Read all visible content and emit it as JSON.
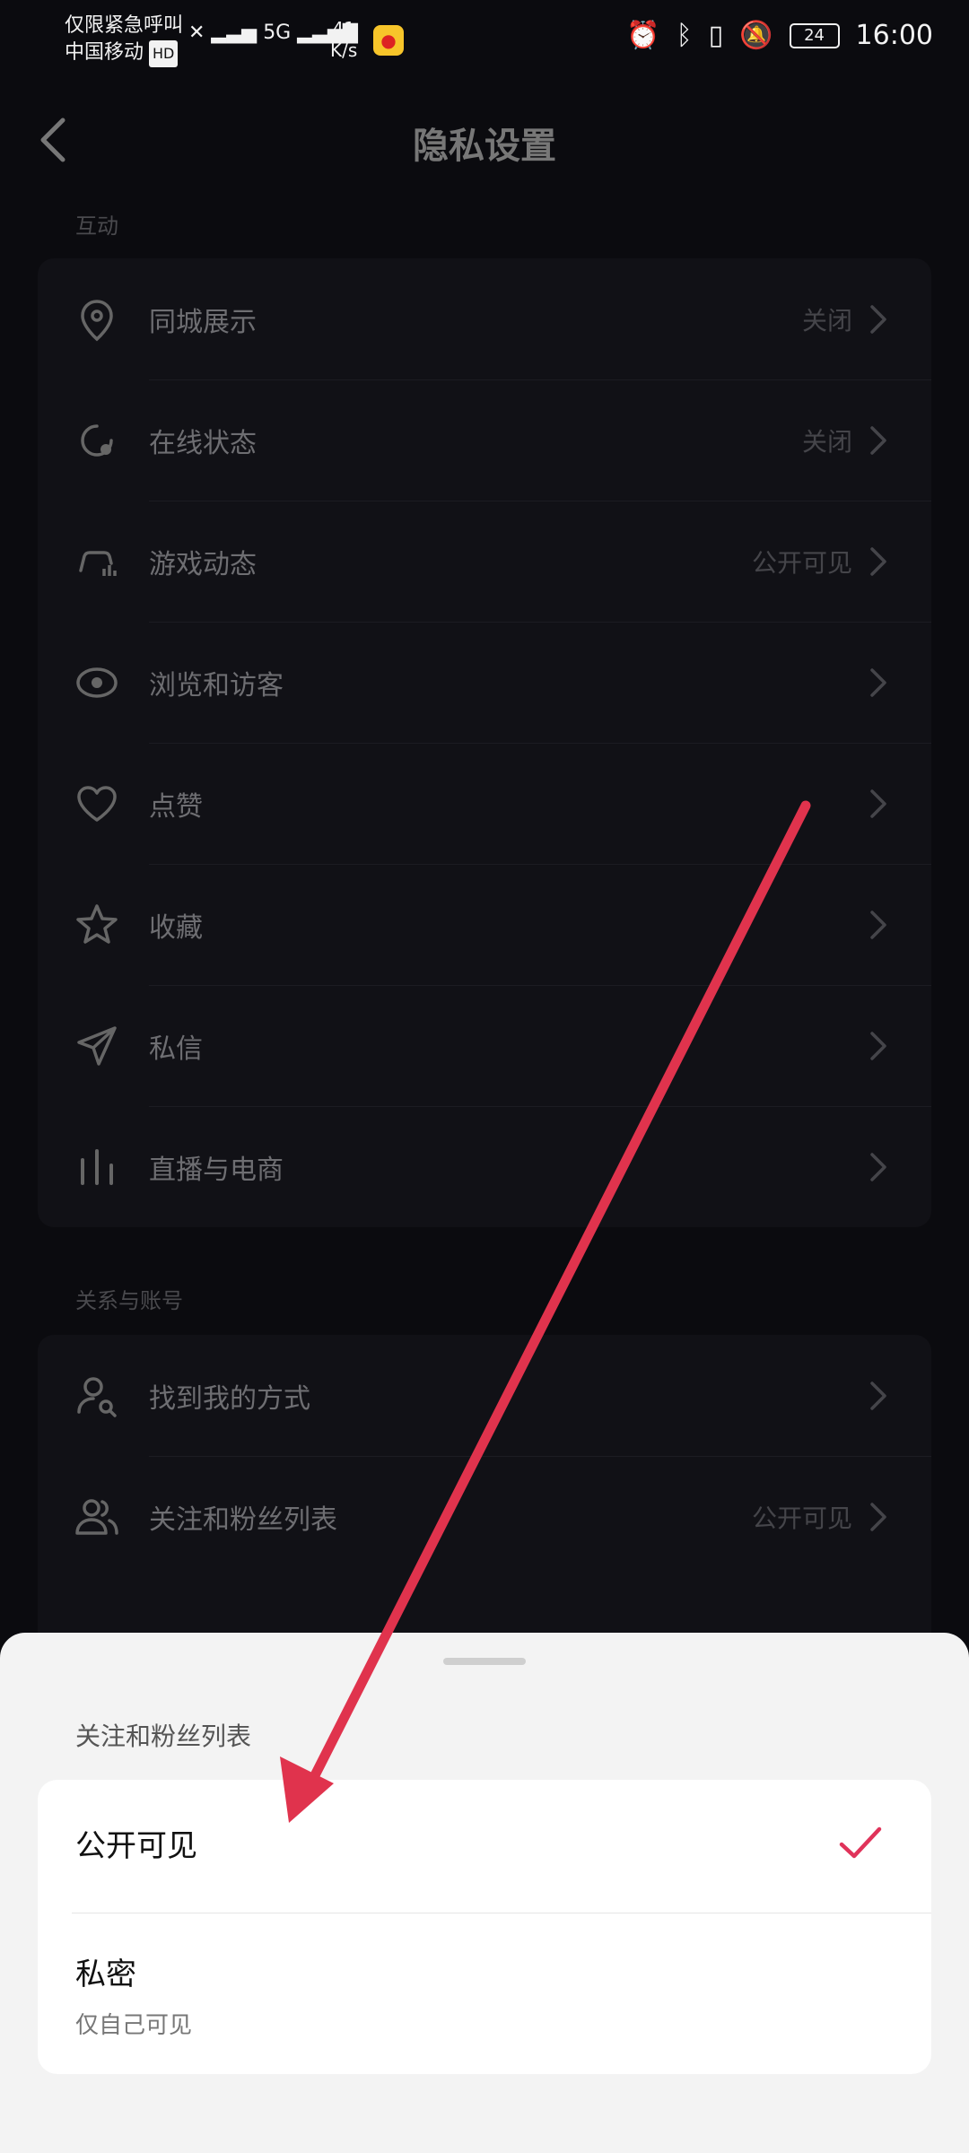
{
  "status_bar": {
    "line1": "仅限紧急呼叫",
    "line2": "中国移动",
    "hd": "HD",
    "network": "5G",
    "speed_value": "41",
    "speed_unit": "K/s",
    "battery": "24",
    "time": "16:00"
  },
  "header": {
    "title": "隐私设置"
  },
  "sections": [
    {
      "label": "互动",
      "items": [
        {
          "label": "同城展示",
          "value": "关闭",
          "icon": "location-pin-icon"
        },
        {
          "label": "在线状态",
          "value": "关闭",
          "icon": "online-status-icon"
        },
        {
          "label": "游戏动态",
          "value": "公开可见",
          "icon": "game-controller-icon"
        },
        {
          "label": "浏览和访客",
          "value": "",
          "icon": "eye-icon"
        },
        {
          "label": "点赞",
          "value": "",
          "icon": "heart-icon"
        },
        {
          "label": "收藏",
          "value": "",
          "icon": "star-icon"
        },
        {
          "label": "私信",
          "value": "",
          "icon": "paper-plane-icon"
        },
        {
          "label": "直播与电商",
          "value": "",
          "icon": "bars-icon"
        }
      ]
    },
    {
      "label": "关系与账号",
      "items": [
        {
          "label": "找到我的方式",
          "value": "",
          "icon": "person-search-icon"
        },
        {
          "label": "关注和粉丝列表",
          "value": "公开可见",
          "icon": "people-icon"
        }
      ]
    }
  ],
  "sheet": {
    "title": "关注和粉丝列表",
    "options": [
      {
        "label": "公开可见",
        "selected": true
      },
      {
        "label": "私密",
        "sublabel": "仅自己可见",
        "selected": false
      }
    ]
  },
  "colors": {
    "accent_check": "#e0335a",
    "annotation_arrow": "#e0334d"
  }
}
